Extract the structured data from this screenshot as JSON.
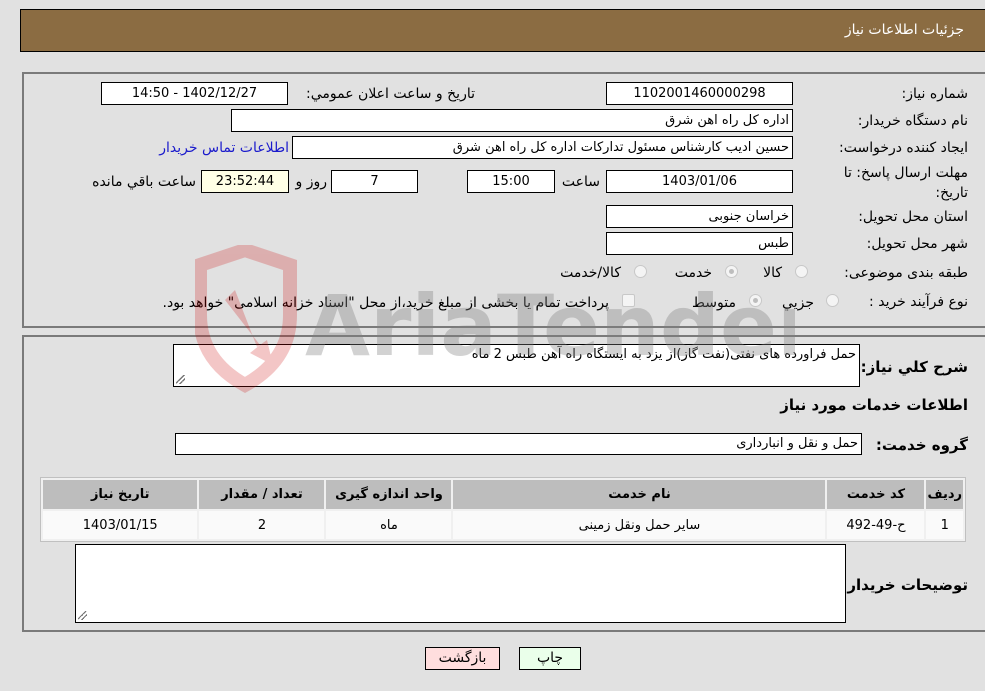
{
  "header": {
    "title": "جزئیات اطلاعات نیاز"
  },
  "form": {
    "need_number": {
      "label": "شماره نیاز:",
      "value": "1102001460000298"
    },
    "announce_datetime": {
      "label": "تاریخ و ساعت اعلان عمومي:",
      "value": "1402/12/27 - 14:50"
    },
    "buyer_org": {
      "label": "نام دستگاه خريدار:",
      "value": "اداره کل راه اهن شرق"
    },
    "requester": {
      "label": "ايجاد کننده درخواست:",
      "value": "حسین ادیب کارشناس مسئول تدارکات اداره کل راه اهن شرق"
    },
    "buyer_contact_link": "اطلاعات تماس خريدار",
    "deadline": {
      "label": "مهلت ارسال پاسخ: تا تاریخ:",
      "date": "1403/01/06",
      "time_label": "ساعت",
      "time": "15:00",
      "days": "7",
      "days_label": "روز و",
      "remaining": "23:52:44",
      "remaining_label": "ساعت باقي مانده"
    },
    "province": {
      "label": "استان محل تحويل:",
      "value": "خراسان جنوبی"
    },
    "city": {
      "label": "شهر محل تحويل:",
      "value": "طبس"
    },
    "category": {
      "label": "طبقه بندی موضوعی:",
      "options": [
        "کالا",
        "خدمت",
        "کالا/خدمت"
      ],
      "selected": "خدمت"
    },
    "purchase_type": {
      "label": "نوع فرآيند خريد :",
      "options": [
        "جزيي",
        "متوسط"
      ],
      "selected": "متوسط",
      "treasury_note": "پرداخت تمام يا بخشی از مبلغ خريد،از محل \"اسناد خزانه اسلامی\" خواهد بود."
    }
  },
  "description": {
    "label": "شرح کلي نياز:",
    "value": "حمل فراورده های نفتی(نفت گاز)از یزد به ایستگاه راه آهن طبس     2 ماه"
  },
  "services_section": {
    "title": "اطلاعات خدمات مورد نياز",
    "group_label": "گروه خدمت:",
    "group_value": "حمل و نقل و انبارداری",
    "table": {
      "headers": [
        "رديف",
        "کد خدمت",
        "نام خدمت",
        "واحد اندازه گيری",
        "تعداد / مقدار",
        "تاریخ نیاز"
      ],
      "rows": [
        [
          "1",
          "ح-49-492",
          "ساير حمل ونقل زمينی",
          "ماه",
          "2",
          "1403/01/15"
        ]
      ]
    }
  },
  "buyer_notes": {
    "label": "توضيحات خريدار:",
    "value": ""
  },
  "buttons": {
    "print": "چاپ",
    "back": "بازگشت"
  },
  "watermark": {
    "text": "AriaTender.neT"
  },
  "colors": {
    "header_bg": "#8b6c42",
    "print_bg": "#eaffea",
    "back_bg": "#ffdede",
    "remaining_bg": "#ffffe6"
  }
}
